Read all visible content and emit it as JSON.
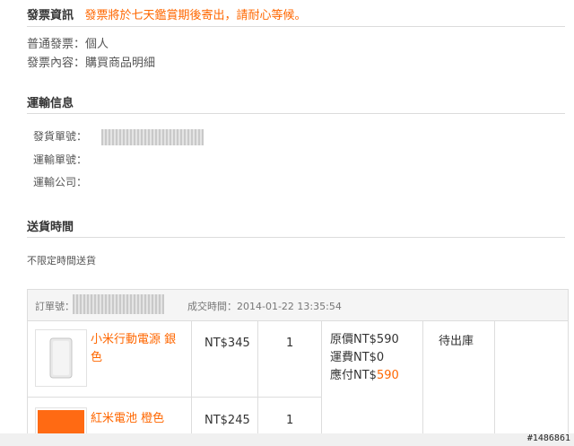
{
  "invoice": {
    "title": "發票資訊",
    "notice": "發票將於七天鑑賞期後寄出，請耐心等候。",
    "type_line": "普通發票：個人",
    "content_line": "發票內容：購買商品明細"
  },
  "shipping": {
    "title": "運輸信息",
    "shipment_no_label": "發貨單號：",
    "tracking_no_label": "運輸單號：",
    "carrier_label": "運輸公司："
  },
  "delivery": {
    "title": "送貨時間",
    "value": "不限定時間送貨"
  },
  "order": {
    "number_label": "訂單號：",
    "deal_time": "成交時間：2014-01-22 13:35:54",
    "items": [
      {
        "name": "小米行動電源 銀色",
        "price": "NT$345",
        "qty": "1",
        "thumb_icon": "power-bank-icon"
      },
      {
        "name": "紅米電池 橙色",
        "price": "NT$245",
        "qty": "1",
        "thumb_icon": "battery-icon"
      }
    ],
    "summary": {
      "original": "原價NT$590",
      "shipping": "運費NT$0",
      "payable_label": "應付NT$",
      "payable_value": "590"
    },
    "status": "待出庫"
  },
  "watermark": "#1486861",
  "colors": {
    "accent": "#ff6700",
    "border": "#dddddd",
    "header_bg": "#f5f5f5"
  }
}
